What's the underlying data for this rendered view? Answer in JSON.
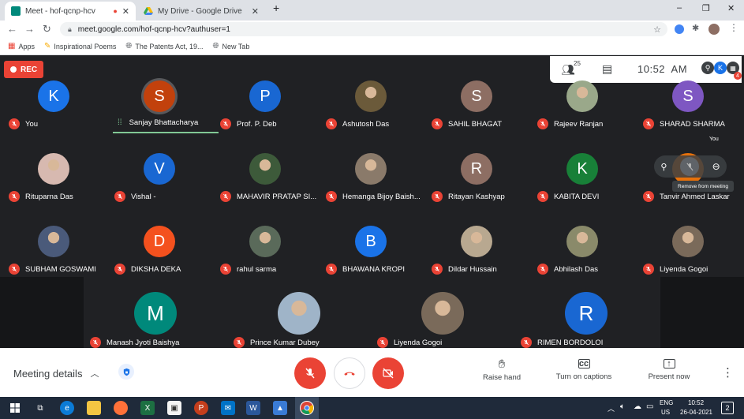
{
  "browser": {
    "tabs": [
      {
        "label": "Meet - hof-qcnp-hcv",
        "recording_dot": "●",
        "close": "✕",
        "favicon_color": "#00897b"
      },
      {
        "label": "My Drive - Google Drive",
        "close": "✕"
      }
    ],
    "new_tab": "+",
    "window_controls": {
      "minimize": "–",
      "maximize": "❐",
      "close": "✕"
    },
    "url": "meet.google.com/hof-qcnp-hcv?authuser=1",
    "bookmarks": [
      {
        "label": "Apps"
      },
      {
        "label": "Inspirational Poems"
      },
      {
        "label": "The Patents Act, 19..."
      },
      {
        "label": "New Tab"
      }
    ]
  },
  "meet": {
    "rec_label": "REC",
    "participant_count": "25",
    "time": "10:52  AM",
    "hover_name": "Tanvir Ahmed Laskar",
    "tooltip": "Remove from meeting",
    "you_label": "You",
    "participants": [
      {
        "name": "You",
        "initial": "K",
        "color": "#1a73e8",
        "muted": true
      },
      {
        "name": "Sanjay Bhattacharya",
        "initial": "S",
        "color": "#c2410c",
        "muted": false,
        "speaking": true
      },
      {
        "name": "Prof. P. Deb",
        "initial": "P",
        "color": "#1967d2",
        "muted": true
      },
      {
        "name": "Ashutosh Das",
        "photo": true,
        "photo_color": "#6b5a3a",
        "muted": true
      },
      {
        "name": "SAHIL BHAGAT",
        "initial": "S",
        "color": "#8d6e63",
        "muted": true
      },
      {
        "name": "Rajeev Ranjan",
        "photo": true,
        "photo_color": "#9aa88a",
        "muted": true
      },
      {
        "name": "SHARAD SHARMA",
        "initial": "S",
        "color": "#7e57c2",
        "muted": true
      },
      {
        "name": "Rituparna Das",
        "photo": true,
        "photo_color": "#d7b9b0",
        "muted": true
      },
      {
        "name": "Vishal -",
        "initial": "V",
        "color": "#1967d2",
        "muted": true
      },
      {
        "name": "MAHAVIR PRATAP SI...",
        "photo": true,
        "photo_color": "#3d5a3a",
        "muted": true
      },
      {
        "name": "Hemanga Bijoy Baish...",
        "photo": true,
        "photo_color": "#8a7a6a",
        "muted": true
      },
      {
        "name": "Ritayan Kashyap",
        "initial": "R",
        "color": "#8d6e63",
        "muted": true
      },
      {
        "name": "KABITA DEVI",
        "initial": "K",
        "color": "#188038",
        "muted": true
      },
      {
        "name": "Tanvir Ahmed Laskar",
        "initial": "T",
        "color": "#e8710a",
        "muted": true,
        "hovered": true
      },
      {
        "name": "SUBHAM GOSWAMI",
        "photo": true,
        "photo_color": "#4a5a7a",
        "muted": true
      },
      {
        "name": "DIKSHA DEKA",
        "initial": "D",
        "color": "#f4511e",
        "muted": true
      },
      {
        "name": "rahul sarma",
        "photo": true,
        "photo_color": "#5a6a5a",
        "muted": true
      },
      {
        "name": "BHAWANA KROPI",
        "initial": "B",
        "color": "#1a73e8",
        "muted": true
      },
      {
        "name": "Dildar Hussain",
        "photo": true,
        "photo_color": "#b8a890",
        "muted": true
      },
      {
        "name": "Abhilash Das",
        "photo": true,
        "photo_color": "#8a8a6a",
        "muted": true
      },
      {
        "name": "Liyenda Gogoi",
        "photo": true,
        "photo_color": "#7a6a5a",
        "muted": true
      }
    ],
    "large_participants": [
      {
        "name": "Manash Jyoti Baishya",
        "initial": "M",
        "color": "#00897b",
        "muted": true
      },
      {
        "name": "Prince Kumar Dubey",
        "photo": true,
        "photo_color": "#9fb4c8",
        "muted": true
      },
      {
        "name": "Liyenda Gogoi",
        "photo": true,
        "photo_color": "#7a6a5a",
        "muted": true
      },
      {
        "name": "RIMEN BORDOLOI",
        "initial": "R",
        "color": "#1967d2",
        "muted": true
      }
    ],
    "bottom": {
      "meeting_details": "Meeting details",
      "raise_hand": "Raise hand",
      "captions": "Turn on captions",
      "present": "Present now"
    }
  },
  "taskbar": {
    "lang": "ENG",
    "region": "US",
    "time": "10:52",
    "date": "26-04-2021",
    "notifications": "2"
  }
}
